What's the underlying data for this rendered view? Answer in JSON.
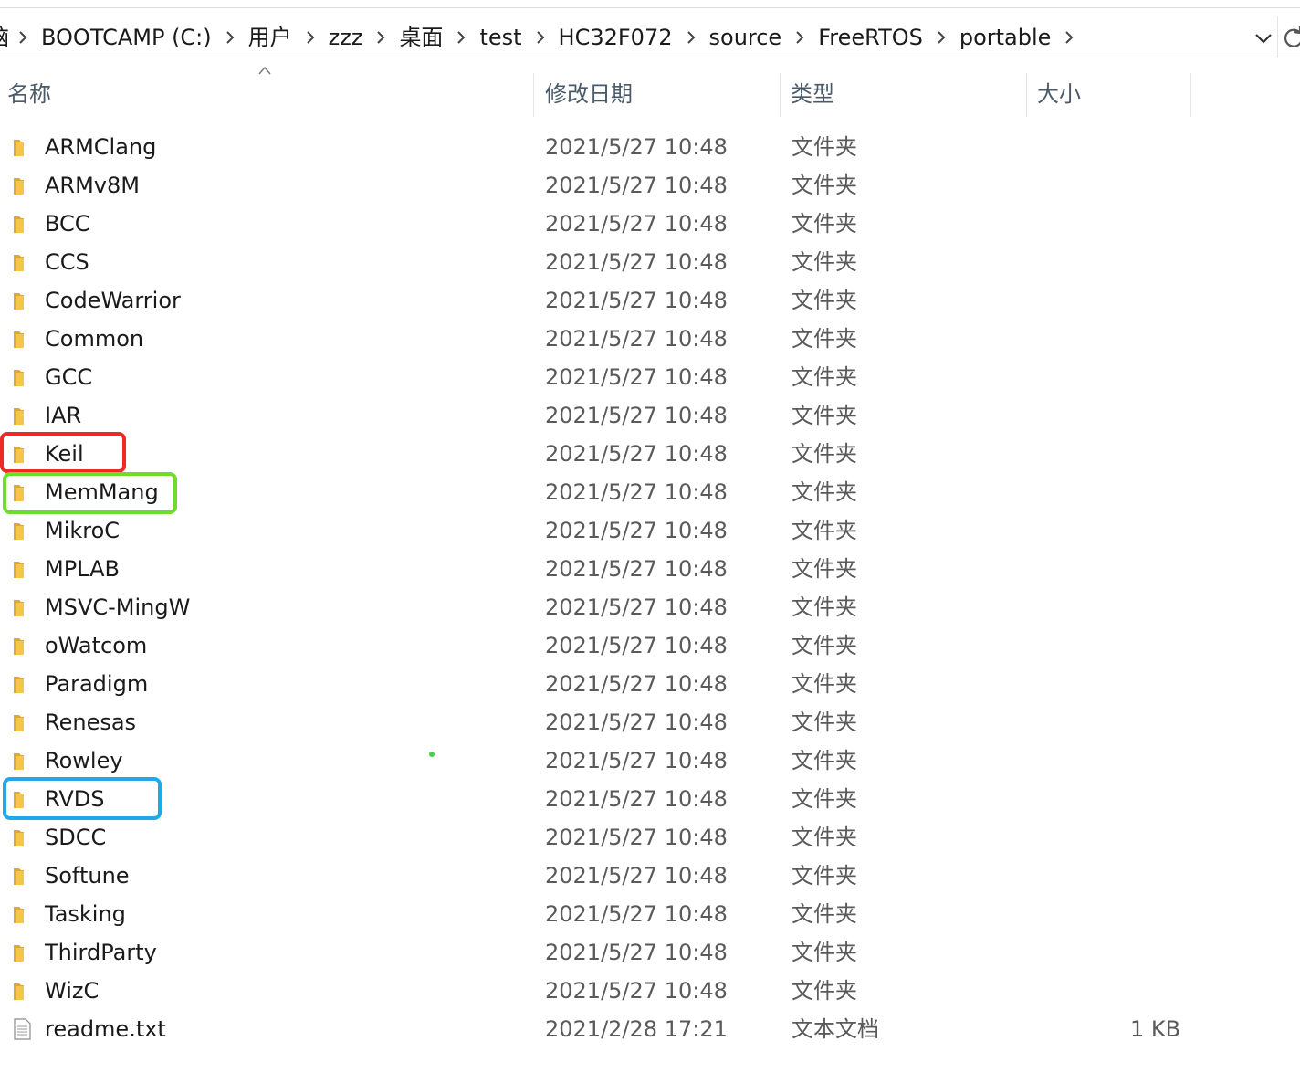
{
  "address_bar": {
    "leading_fragment": "脑",
    "crumbs": [
      "BOOTCAMP (C:)",
      "用户",
      "zzz",
      "桌面",
      "test",
      "HC32F072",
      "source",
      "FreeRTOS",
      "portable"
    ]
  },
  "columns": {
    "name": "名称",
    "modified": "修改日期",
    "type": "类型",
    "size": "大小"
  },
  "files": [
    {
      "name": "ARMClang",
      "modified": "2021/5/27 10:48",
      "type": "文件夹",
      "size": "",
      "icon": "folder-icon"
    },
    {
      "name": "ARMv8M",
      "modified": "2021/5/27 10:48",
      "type": "文件夹",
      "size": "",
      "icon": "folder-icon"
    },
    {
      "name": "BCC",
      "modified": "2021/5/27 10:48",
      "type": "文件夹",
      "size": "",
      "icon": "folder-icon"
    },
    {
      "name": "CCS",
      "modified": "2021/5/27 10:48",
      "type": "文件夹",
      "size": "",
      "icon": "folder-icon"
    },
    {
      "name": "CodeWarrior",
      "modified": "2021/5/27 10:48",
      "type": "文件夹",
      "size": "",
      "icon": "folder-icon"
    },
    {
      "name": "Common",
      "modified": "2021/5/27 10:48",
      "type": "文件夹",
      "size": "",
      "icon": "folder-icon"
    },
    {
      "name": "GCC",
      "modified": "2021/5/27 10:48",
      "type": "文件夹",
      "size": "",
      "icon": "folder-icon"
    },
    {
      "name": "IAR",
      "modified": "2021/5/27 10:48",
      "type": "文件夹",
      "size": "",
      "icon": "folder-icon"
    },
    {
      "name": "Keil",
      "modified": "2021/5/27 10:48",
      "type": "文件夹",
      "size": "",
      "icon": "folder-icon"
    },
    {
      "name": "MemMang",
      "modified": "2021/5/27 10:48",
      "type": "文件夹",
      "size": "",
      "icon": "folder-icon"
    },
    {
      "name": "MikroC",
      "modified": "2021/5/27 10:48",
      "type": "文件夹",
      "size": "",
      "icon": "folder-icon"
    },
    {
      "name": "MPLAB",
      "modified": "2021/5/27 10:48",
      "type": "文件夹",
      "size": "",
      "icon": "folder-icon"
    },
    {
      "name": "MSVC-MingW",
      "modified": "2021/5/27 10:48",
      "type": "文件夹",
      "size": "",
      "icon": "folder-icon"
    },
    {
      "name": "oWatcom",
      "modified": "2021/5/27 10:48",
      "type": "文件夹",
      "size": "",
      "icon": "folder-icon"
    },
    {
      "name": "Paradigm",
      "modified": "2021/5/27 10:48",
      "type": "文件夹",
      "size": "",
      "icon": "folder-icon"
    },
    {
      "name": "Renesas",
      "modified": "2021/5/27 10:48",
      "type": "文件夹",
      "size": "",
      "icon": "folder-icon"
    },
    {
      "name": "Rowley",
      "modified": "2021/5/27 10:48",
      "type": "文件夹",
      "size": "",
      "icon": "folder-icon"
    },
    {
      "name": "RVDS",
      "modified": "2021/5/27 10:48",
      "type": "文件夹",
      "size": "",
      "icon": "folder-icon"
    },
    {
      "name": "SDCC",
      "modified": "2021/5/27 10:48",
      "type": "文件夹",
      "size": "",
      "icon": "folder-icon"
    },
    {
      "name": "Softune",
      "modified": "2021/5/27 10:48",
      "type": "文件夹",
      "size": "",
      "icon": "folder-icon"
    },
    {
      "name": "Tasking",
      "modified": "2021/5/27 10:48",
      "type": "文件夹",
      "size": "",
      "icon": "folder-icon"
    },
    {
      "name": "ThirdParty",
      "modified": "2021/5/27 10:48",
      "type": "文件夹",
      "size": "",
      "icon": "folder-icon"
    },
    {
      "name": "WizC",
      "modified": "2021/5/27 10:48",
      "type": "文件夹",
      "size": "",
      "icon": "folder-icon"
    },
    {
      "name": "readme.txt",
      "modified": "2021/2/28 17:21",
      "type": "文本文档",
      "size": "1 KB",
      "icon": "text-file-icon"
    }
  ],
  "highlights": [
    {
      "target": "Keil",
      "color": "#ee2a24"
    },
    {
      "target": "MemMang",
      "color": "#6fdc2c"
    },
    {
      "target": "RVDS",
      "color": "#1fa8ea"
    }
  ],
  "colors": {
    "folder": "#f4c64a",
    "folder_dark": "#e0a92a",
    "header_text": "#4a5a6a",
    "stray_dot": "#44d24a"
  }
}
